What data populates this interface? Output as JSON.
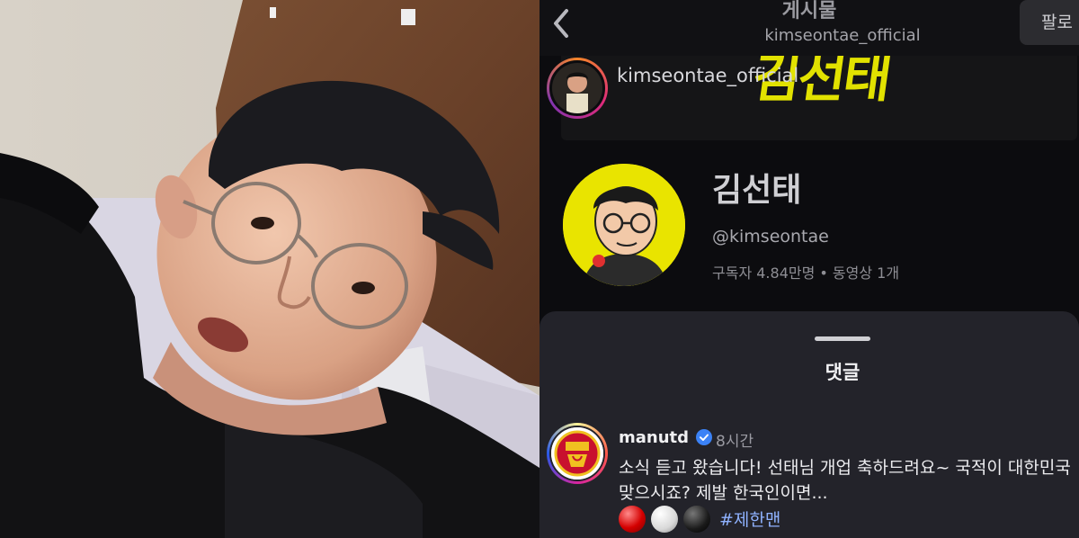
{
  "post_view": {
    "header": {
      "title": "게시물",
      "subtitle": "kimseontae_official",
      "follow_label": "팔로"
    },
    "post": {
      "username": "kimseontae_official",
      "banner_text": "김선태"
    },
    "channel": {
      "name": "김선태",
      "handle": "@kimseontae",
      "meta": "구독자 4.84만명 • 동영상 1개"
    }
  },
  "comments_sheet": {
    "title": "댓글",
    "comment": {
      "username": "manutd",
      "time": "8시간",
      "text": "소식 듣고 왔습니다! 선태님 개업 축하드려요~ 국적이 대한민국 맞으시죠? 제발 한국인이면...",
      "hashtag": "#제한맨"
    }
  },
  "colors": {
    "accent_yellow": "#e9e400",
    "hashtag_blue": "#8fb2ff",
    "sheet_bg": "#23232a"
  }
}
